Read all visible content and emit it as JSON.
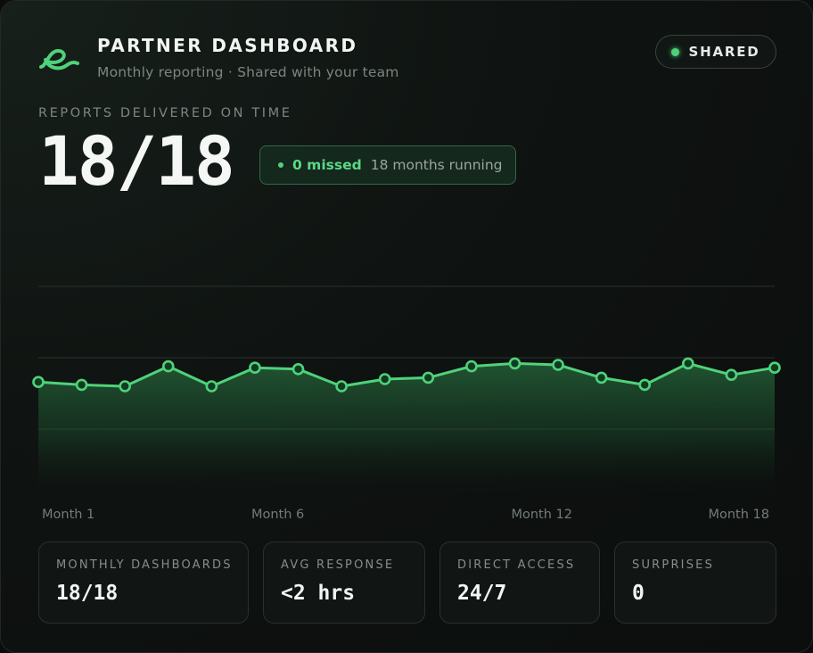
{
  "header": {
    "title": "PARTNER DASHBOARD",
    "subtitle": "Monthly reporting · Shared with your team",
    "logo_icon": "infinity-wave-icon",
    "status_badge": {
      "label": "SHARED",
      "color": "#4fd27a"
    }
  },
  "kpi": {
    "label": "REPORTS DELIVERED ON TIME",
    "value": "18/18",
    "badge": {
      "count": "0 missed",
      "note": "18 months running"
    }
  },
  "colors": {
    "accent": "#4fd27a",
    "background": "#0f1311",
    "grid": "#2a312d"
  },
  "chart_data": {
    "type": "area",
    "x_tick_labels": [
      "Month 1",
      "Month 6",
      "Month 12",
      "Month 18"
    ],
    "x": [
      1,
      2,
      3,
      4,
      5,
      6,
      7,
      8,
      9,
      10,
      11,
      12,
      13,
      14,
      15,
      16,
      17,
      18
    ],
    "series": [
      {
        "values": [
          0.83,
          0.81,
          0.8,
          0.94,
          0.8,
          0.93,
          0.92,
          0.8,
          0.85,
          0.86,
          0.94,
          0.96,
          0.95,
          0.86,
          0.81,
          0.96,
          0.88,
          0.93
        ],
        "color": "#4fd27a"
      }
    ],
    "ylim": [
      0,
      1.5
    ],
    "grid": true,
    "legend": "none"
  },
  "stats": [
    {
      "label": "MONTHLY DASHBOARDS",
      "value": "18/18"
    },
    {
      "label": "AVG RESPONSE",
      "value": "<2 hrs"
    },
    {
      "label": "DIRECT ACCESS",
      "value": "24/7"
    },
    {
      "label": "SURPRISES",
      "value": "0"
    }
  ]
}
